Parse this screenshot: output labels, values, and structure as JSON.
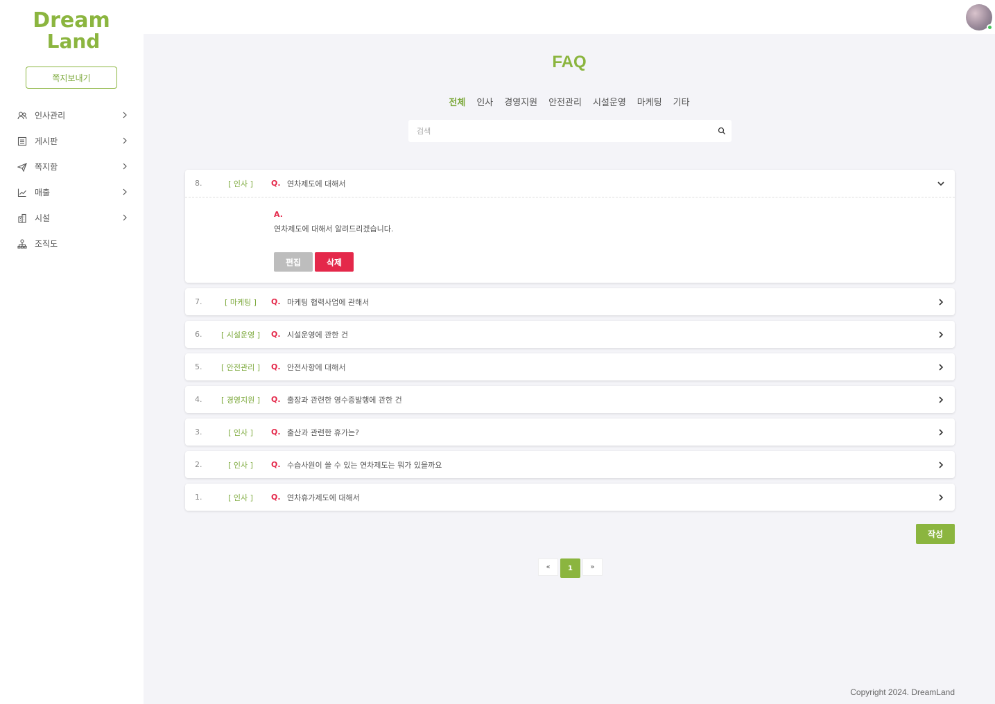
{
  "brand": {
    "logo_line1": "Dream",
    "logo_line2": "Land",
    "accent": "#8bb53f",
    "danger": "#e4284a"
  },
  "sidebar": {
    "send_button": "쪽지보내기",
    "items": [
      {
        "label": "인사관리",
        "icon": "users-icon",
        "has_chevron": true
      },
      {
        "label": "게시판",
        "icon": "board-icon",
        "has_chevron": true
      },
      {
        "label": "쪽지함",
        "icon": "send-icon",
        "has_chevron": true
      },
      {
        "label": "매출",
        "icon": "chart-icon",
        "has_chevron": true
      },
      {
        "label": "시설",
        "icon": "building-icon",
        "has_chevron": true
      },
      {
        "label": "조직도",
        "icon": "org-icon",
        "has_chevron": false
      }
    ]
  },
  "main": {
    "title": "FAQ",
    "tabs": [
      {
        "label": "전체",
        "active": true
      },
      {
        "label": "인사",
        "active": false
      },
      {
        "label": "경영지원",
        "active": false
      },
      {
        "label": "안전관리",
        "active": false
      },
      {
        "label": "시설운영",
        "active": false
      },
      {
        "label": "마케팅",
        "active": false
      },
      {
        "label": "기타",
        "active": false
      }
    ],
    "search_placeholder": "검색",
    "faqs": [
      {
        "num": "8.",
        "category": "[ 인사 ]",
        "q": "Q.",
        "title": "연차제도에 대해서",
        "expanded": true,
        "a": "A.",
        "answer": "연차제도에 대해서  알려드리겠습니다.",
        "edit": "편집",
        "delete": "삭제"
      },
      {
        "num": "7.",
        "category": "[ 마케팅 ]",
        "q": "Q.",
        "title": "마케팅 협력사업에 관해서"
      },
      {
        "num": "6.",
        "category": "[ 시설운영 ]",
        "q": "Q.",
        "title": "시설운영에 관한 건"
      },
      {
        "num": "5.",
        "category": "[ 안전관리 ]",
        "q": "Q.",
        "title": "안전사항에 대해서"
      },
      {
        "num": "4.",
        "category": "[ 경영지원 ]",
        "q": "Q.",
        "title": "출장과 관련한 영수증발행에 관한 건"
      },
      {
        "num": "3.",
        "category": "[ 인사 ]",
        "q": "Q.",
        "title": "출산과 관련한 휴가는?"
      },
      {
        "num": "2.",
        "category": "[ 인사 ]",
        "q": "Q.",
        "title": "수습사원이 쓸 수 있는 연차제도는 뭐가 있을까요"
      },
      {
        "num": "1.",
        "category": "[ 인사 ]",
        "q": "Q.",
        "title": "연차휴가제도에 대해서"
      }
    ],
    "write_button": "작성",
    "pagination": {
      "prev": "«",
      "current": "1",
      "next": "»"
    }
  },
  "footer": {
    "copyright": "Copyright 2024. DreamLand"
  }
}
